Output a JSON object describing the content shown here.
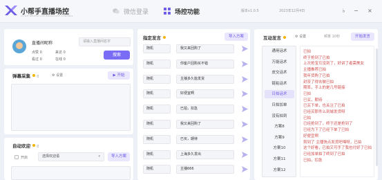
{
  "app": {
    "name": "小帮手直播场控",
    "tagline": "LITTLE HELPER LIVE BROADCAST CONTROL"
  },
  "nav": {
    "tabs": [
      {
        "label": "微信登录",
        "active": false
      },
      {
        "label": "场控功能",
        "active": true
      }
    ]
  },
  "header": {
    "version": "版本v1.0.5",
    "date": "2023年12月4日"
  },
  "user": {
    "name": "直播间昵称",
    "stats": [
      {
        "label": "点赞",
        "value": "0"
      },
      {
        "label": "来访",
        "value": "0"
      },
      {
        "label": "看过",
        "value": "0"
      },
      {
        "label": "在线",
        "value": "0"
      }
    ],
    "room_placeholder": "请输入直播间名字",
    "search_label": "搜索"
  },
  "danmu": {
    "title": "弹幕采集",
    "count": "0",
    "settings": "设置",
    "start": "开始"
  },
  "welcome": {
    "title": "自动欢迎",
    "count": "0",
    "enable": "开启",
    "select_placeholder": "选择欢迎语",
    "import": "导入方案"
  },
  "assign": {
    "title": "指定发言",
    "import": "导入方案",
    "rows": [
      {
        "mode": "随机",
        "text": "我又来回购了"
      },
      {
        "mode": "随机",
        "text": "你客户回购买不错"
      },
      {
        "mode": "随机",
        "text": "主播多久能发货"
      },
      {
        "mode": "随机",
        "text": "好便宜啊"
      },
      {
        "mode": "随机",
        "text": "已拍，扣急"
      },
      {
        "mode": "随机",
        "text": "我又来回购了"
      },
      {
        "mode": "随机",
        "text": "已买，期待"
      },
      {
        "mode": "随机",
        "text": "上海多久发出"
      },
      {
        "mode": "随机",
        "text": "主播666"
      }
    ]
  },
  "interact": {
    "title": "互动发言",
    "settings": "设置",
    "interval_label": "频率 10秒",
    "start": "开始发言",
    "categories": [
      "通用话术",
      "万能话术",
      "皮交话术",
      "链粘话术",
      "日拍话术",
      "日拍加单",
      "没有拍到",
      "方案8",
      "方案9",
      "方案10",
      "方案11",
      "方案12"
    ],
    "active_index": 4,
    "lines": [
      "已拍",
      "终于抢到了已拍",
      "上次抢宝贝没到了，好讲了者需美女",
      "主播推荐已拍",
      "我年货购了已拍",
      "封奈了得去做已拍",
      "期率，手上的是几号链接",
      "已拍",
      "已买，期待",
      "已买下单，也关注了已拍",
      "已经买那件么到城发货呀",
      "已拍",
      "已经抢到了，终于还是抢到了",
      "已经为下了已经下单了已拍",
      "好便宜啊",
      "剪到了 主播快点发货吧嘿呀，已拍",
      "这个好看，已拍又可手了我也付好了已拍",
      "已经加单拍了终到了已拍",
      "已拍，扣急"
    ]
  }
}
